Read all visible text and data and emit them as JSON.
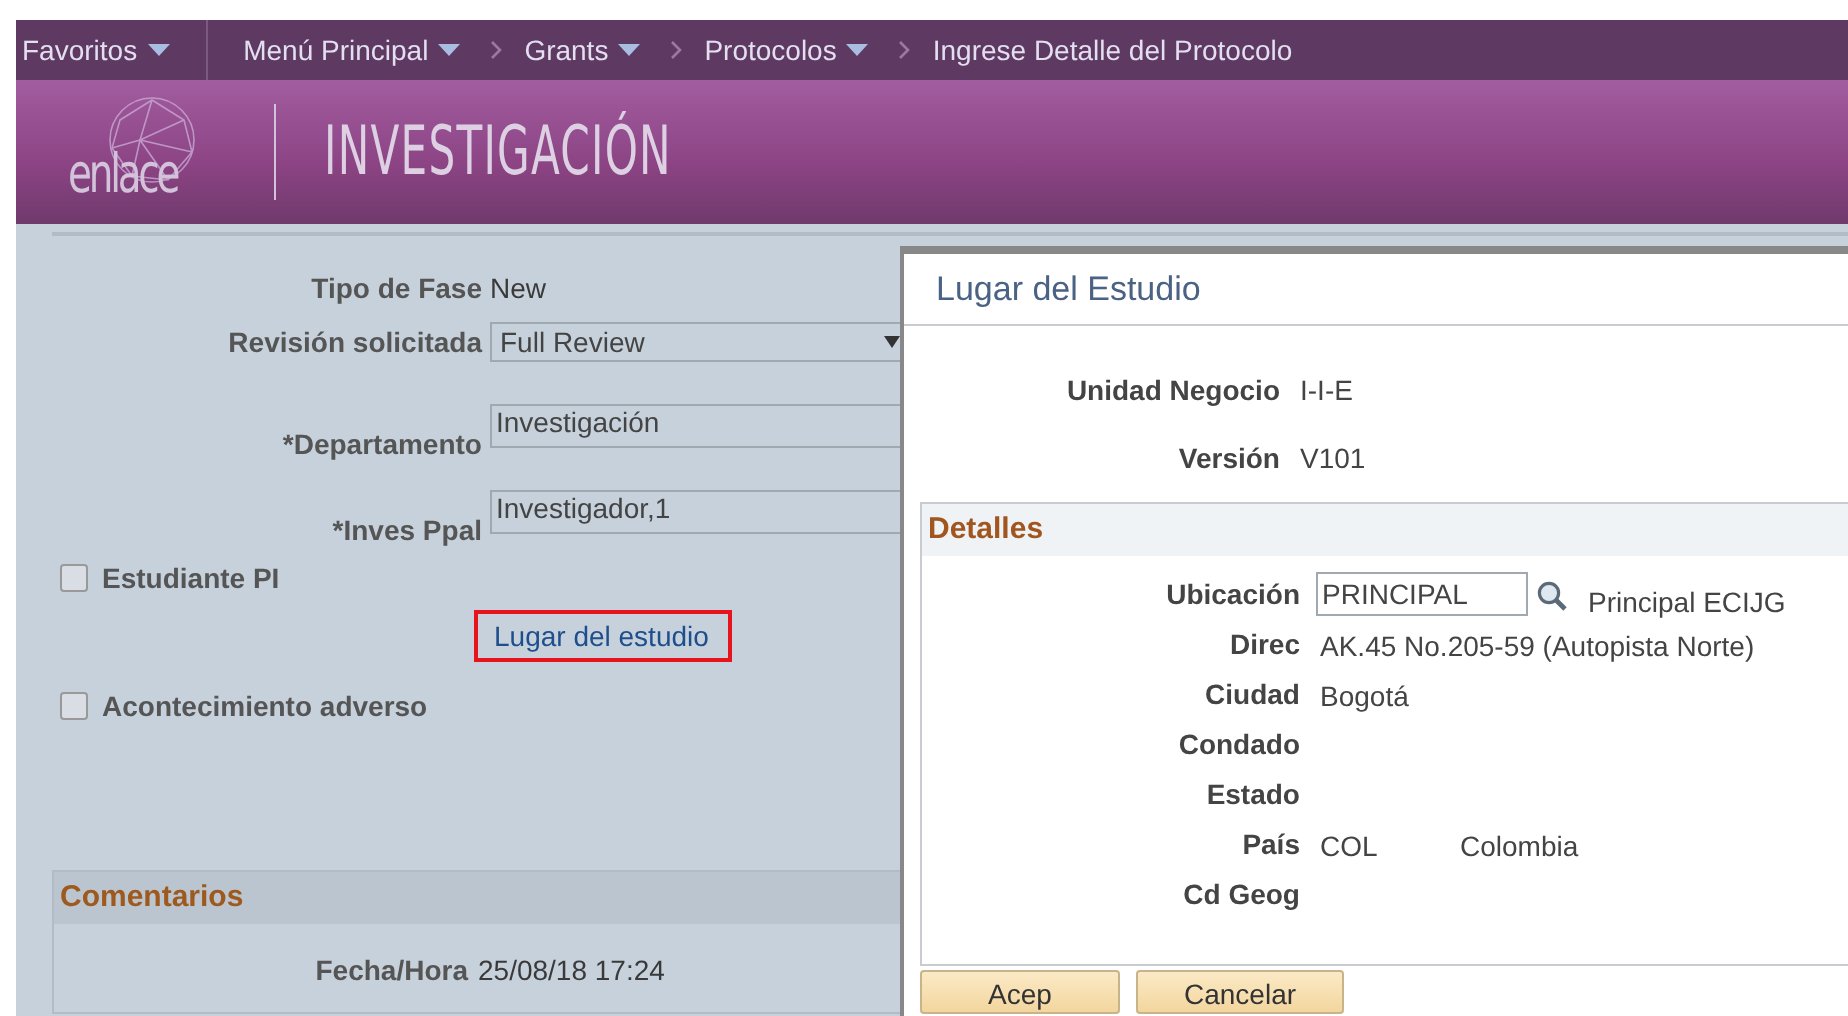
{
  "nav": [
    {
      "label": "Favoritos",
      "menu": true,
      "crumb": false
    },
    {
      "label": "Menú Principal",
      "menu": true,
      "crumb": false
    },
    {
      "label": "Grants",
      "menu": true,
      "crumb": true
    },
    {
      "label": "Protocolos",
      "menu": true,
      "crumb": true
    },
    {
      "label": "Ingrese Detalle del Protocolo",
      "menu": false,
      "crumb": true
    }
  ],
  "banner": {
    "logo": "enlace",
    "title": "INVESTIGACIÓN"
  },
  "form": {
    "fields": [
      {
        "kind": "text",
        "label": "Tipo de Fase",
        "value": "New"
      },
      {
        "kind": "select",
        "label": "Revisión solicitada",
        "value": "Full Review"
      },
      {
        "kind": "input",
        "label": "*Departamento",
        "value": "Investigación"
      },
      {
        "kind": "input",
        "label": "*Inves Ppal",
        "value": "Investigador,1"
      }
    ],
    "checkboxes": [
      {
        "label": "Estudiante PI",
        "checked": false
      },
      {
        "label": "Acontecimiento adverso",
        "checked": false
      }
    ],
    "link": {
      "label": "Lugar del estudio",
      "highlighted": true
    },
    "comments": {
      "title": "Comentarios",
      "fields": [
        {
          "label": "Fecha/Hora",
          "value": "25/08/18 17:24"
        }
      ]
    }
  },
  "dialog": {
    "title": "Lugar del Estudio",
    "fields": [
      {
        "label": "Unidad Negocio",
        "value": "I-I-E"
      },
      {
        "label": "Versión",
        "value": "V101"
      }
    ],
    "details": {
      "title": "Detalles",
      "rows": [
        {
          "kind": "lookup",
          "label": "Ubicación",
          "value": "PRINCIPAL",
          "description": "Principal ECIJG"
        },
        {
          "kind": "text",
          "label": "Direc",
          "value": "AK.45 No.205-59 (Autopista Norte)"
        },
        {
          "kind": "text",
          "label": "Ciudad",
          "value": "Bogotá"
        },
        {
          "kind": "text",
          "label": "Condado"
        },
        {
          "kind": "text",
          "label": "Estado"
        },
        {
          "kind": "text",
          "label": "País",
          "value": "COL",
          "description": "Colombia"
        },
        {
          "kind": "text",
          "label": "Cd Geog"
        }
      ]
    },
    "buttons": [
      "Acep",
      "Cancelar"
    ]
  }
}
